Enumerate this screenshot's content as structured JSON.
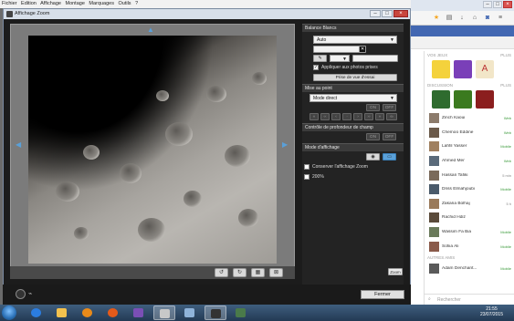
{
  "menubar": {
    "items": [
      "Fichier",
      "Edition",
      "Affichage",
      "Montage",
      "Marquages",
      "Outils",
      "?"
    ]
  },
  "dialog": {
    "title": "Affichage Zoom",
    "close_label": "Fermer",
    "zoom_badge": "Zoom"
  },
  "panel": {
    "balance": {
      "header": "Balance Blancs",
      "mode_value": "Auto",
      "apply_label": "Appliquer aux photos prises",
      "test_button": "Prise de vue d'essai"
    },
    "focus": {
      "header": "Mise au point",
      "mode_value": "Mode direct",
      "on_label": "ON",
      "off_label": "OFF"
    },
    "dof": {
      "header": "Contrôle de profondeur de champ",
      "on_label": "ON",
      "off_label": "OFF"
    },
    "display": {
      "header": "Mode d'affichage",
      "keep_zoom_label": "Conserver l'affichage Zoom",
      "zoom200_label": "200%"
    }
  },
  "chat": {
    "section_apps": "VOS JEUX",
    "section_more": "PLUS",
    "section_contacts": "DISCUSSION",
    "section_others": "AUTRES AMIS",
    "contacts": [
      {
        "name": "Zinch Kaoui",
        "status": "Web"
      },
      {
        "name": "Chemoo Eddine",
        "status": "Web"
      },
      {
        "name": "Lahfil Yasser",
        "status": "Mobile"
      },
      {
        "name": "Ahmed Mer",
        "status": "Web"
      },
      {
        "name": "Hassan Tafiki",
        "status": "5 min"
      },
      {
        "name": "Driss Elmahjoubi",
        "status": "Mobile"
      },
      {
        "name": "Zakaria Bolhaj",
        "status": "5 h"
      },
      {
        "name": "Rachid Hdiz",
        "status": ""
      },
      {
        "name": "Wassim Fa Bia",
        "status": "Mobile"
      },
      {
        "name": "Sofiia Ali",
        "status": "Mobile"
      },
      {
        "name": "Adam Denchant...",
        "status": "Mobile"
      }
    ],
    "search_placeholder": "Rechercher"
  },
  "taskbar": {
    "time": "21:55",
    "date": "23/07/2015"
  },
  "colors": {
    "accent": "#5aa0d8",
    "facebook": "#4267b2",
    "dialog_bg": "#1c1c1c"
  }
}
